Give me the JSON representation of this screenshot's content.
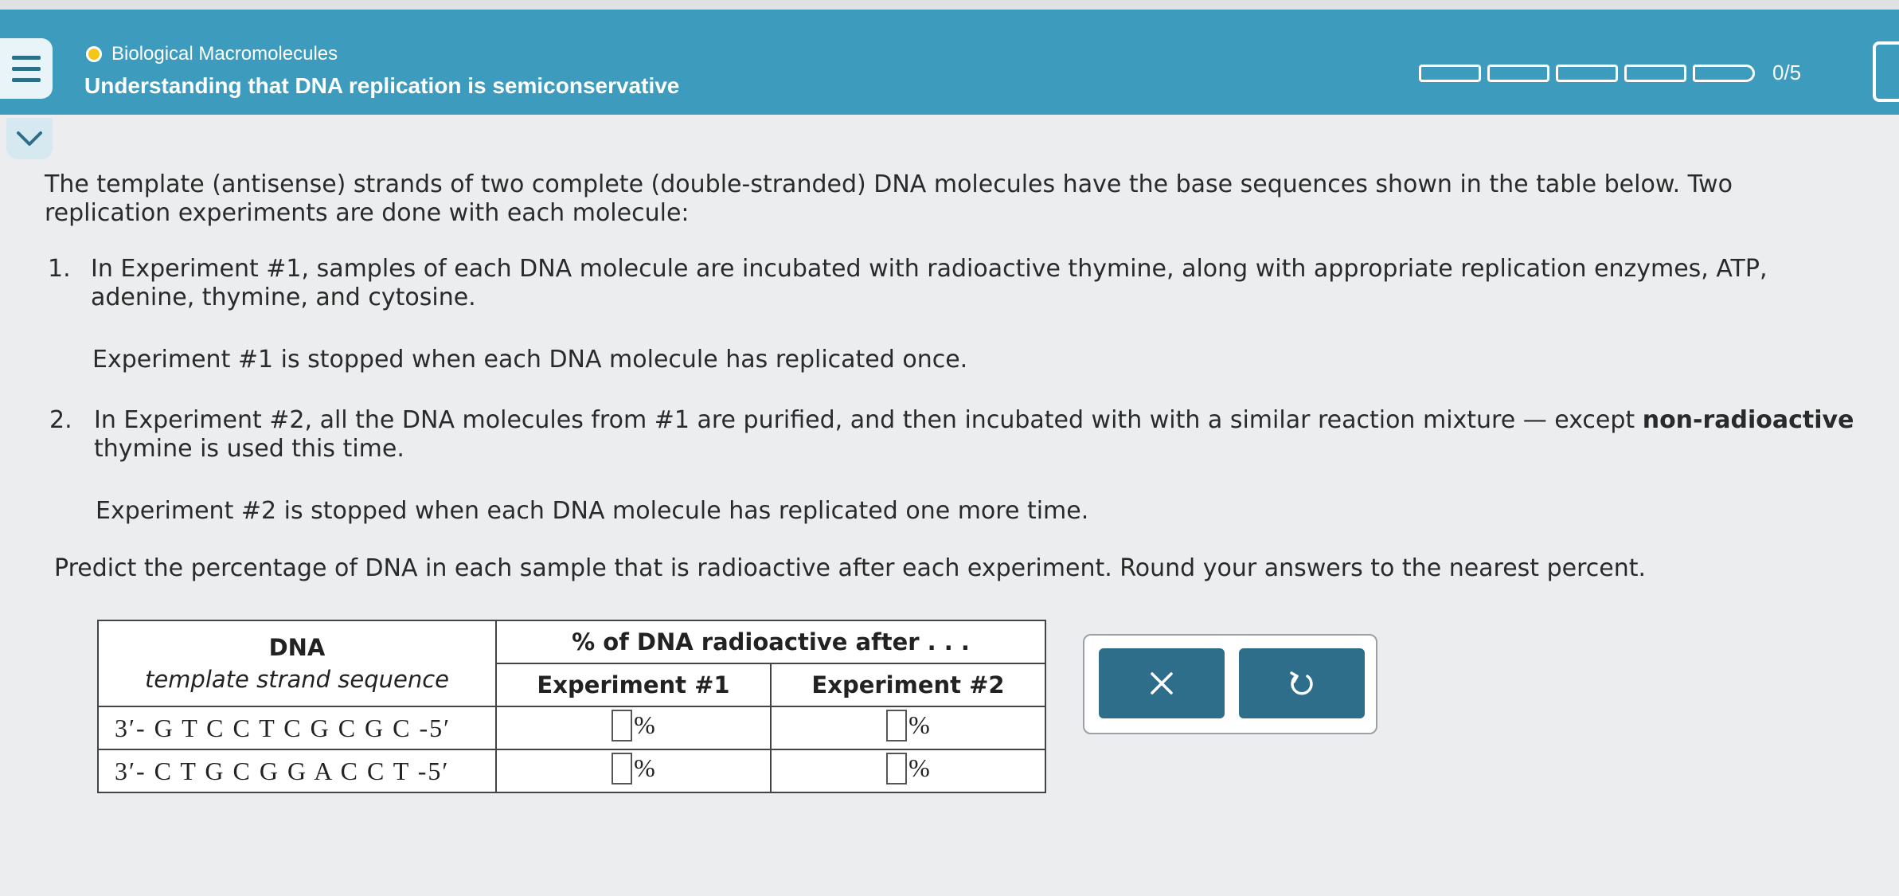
{
  "header": {
    "topic": "Biological Macromolecules",
    "title": "Understanding that DNA replication is semiconservative",
    "progress_text": "0/5",
    "progress_completed": 0,
    "progress_total": 5
  },
  "question": {
    "intro": "The template (antisense) strands of two complete (double-stranded) DNA molecules have the base sequences shown in the table below. Two replication experiments are done with each molecule:",
    "item1_number": "1.",
    "item1_text": "In Experiment #1, samples of each DNA molecule are incubated with radioactive thymine, along with appropriate replication enzymes, ATP, adenine, thymine, and cytosine.",
    "item1_stop": "Experiment #1 is stopped when each DNA molecule has replicated once.",
    "item2_number": "2.",
    "item2_text_a": "In Experiment #2, all the DNA molecules from #1 are purified, and then incubated with with a similar reaction mixture — except ",
    "item2_bold": "non-radioactive",
    "item2_text_b": " thymine is used this time.",
    "item2_stop": "Experiment #2 is stopped when each DNA molecule has replicated one more time.",
    "prompt": "Predict the percentage of DNA in each sample that is radioactive after each experiment. Round your answers to the nearest percent."
  },
  "table": {
    "col1_header": "DNA",
    "col1_subheader": "template strand sequence",
    "group_header": "% of DNA radioactive after . . .",
    "exp1_header": "Experiment #1",
    "exp2_header": "Experiment #2",
    "unit": "%",
    "rows": [
      {
        "sequence": "3′- G T C C T C G C G C -5′",
        "exp1_value": "",
        "exp2_value": ""
      },
      {
        "sequence": "3′- C T G C G G A C C T -5′",
        "exp1_value": "",
        "exp2_value": ""
      }
    ]
  },
  "actions": {
    "clear_icon": "x-icon",
    "undo_icon": "undo-icon"
  },
  "colors": {
    "header_bg": "#3d9bbd",
    "button_bg": "#2f6e8a",
    "topic_dot": "#f5c518"
  }
}
